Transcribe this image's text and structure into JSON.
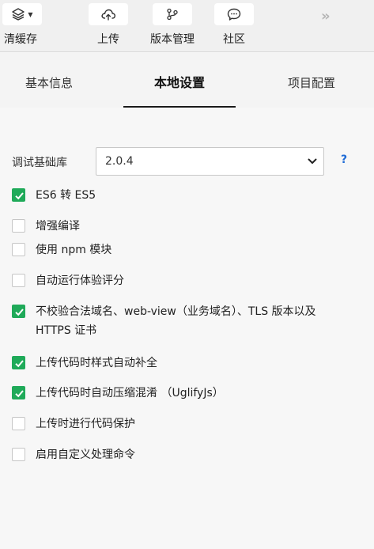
{
  "toolbar": {
    "clear_cache_label": "清缓存",
    "upload_label": "上传",
    "version_label": "版本管理",
    "community_label": "社区",
    "more_glyph": "»"
  },
  "tabs": [
    {
      "label": "基本信息"
    },
    {
      "label": "本地设置",
      "active": true
    },
    {
      "label": "项目配置"
    }
  ],
  "settings": {
    "lib_label": "调试基础库",
    "lib_value": "2.0.4",
    "help_glyph": "?",
    "options": [
      {
        "label": "ES6 转 ES5",
        "checked": true
      },
      {
        "label": "增强编译",
        "checked": false
      },
      {
        "label": "使用 npm 模块",
        "checked": false
      },
      {
        "label": "自动运行体验评分",
        "checked": false
      },
      {
        "label": "不校验合法域名、web-view（业务域名）、TLS 版本以及 HTTPS 证书",
        "checked": true
      },
      {
        "label": "上传代码时样式自动补全",
        "checked": true
      },
      {
        "label": "上传代码时自动压缩混淆 （UglifyJs）",
        "checked": true
      },
      {
        "label": "上传时进行代码保护",
        "checked": false
      },
      {
        "label": "启用自定义处理命令",
        "checked": false
      }
    ]
  },
  "colors": {
    "accent_green": "#1faa59",
    "help_blue": "#1f6bd6"
  }
}
